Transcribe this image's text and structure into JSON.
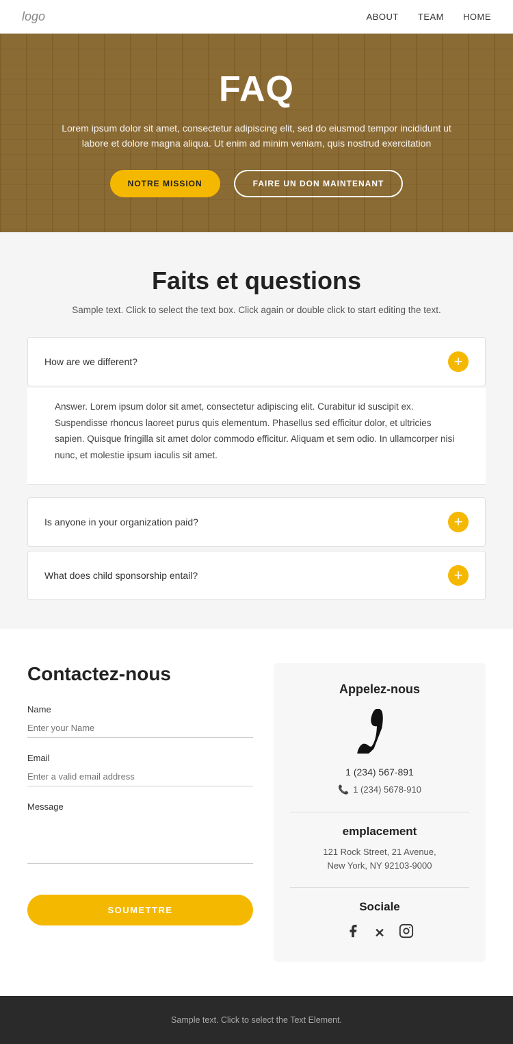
{
  "nav": {
    "logo": "logo",
    "links": [
      {
        "label": "ABOUT",
        "name": "about"
      },
      {
        "label": "TEAM",
        "name": "team"
      },
      {
        "label": "HOME",
        "name": "home"
      }
    ]
  },
  "hero": {
    "title": "FAQ",
    "subtitle": "Lorem ipsum dolor sit amet, consectetur adipiscing elit, sed do eiusmod tempor incididunt ut labore et dolore magna aliqua. Ut enim ad minim veniam, quis nostrud exercitation",
    "btn_primary": "NOTRE MISSION",
    "btn_outline": "FAIRE UN DON MAINTENANT"
  },
  "faq_section": {
    "title": "Faits et questions",
    "subtitle": "Sample text. Click to select the text box. Click again or double click to start editing the text.",
    "items": [
      {
        "question": "How are we different?",
        "answer": "Answer. Lorem ipsum dolor sit amet, consectetur adipiscing elit. Curabitur id suscipit ex. Suspendisse rhoncus laoreet purus quis elementum. Phasellus sed efficitur dolor, et ultricies sapien. Quisque fringilla sit amet dolor commodo efficitur. Aliquam et sem odio. In ullamcorper nisi nunc, et molestie ipsum iaculis sit amet.",
        "open": true
      },
      {
        "question": "Is anyone in your organization paid?",
        "answer": "",
        "open": false
      },
      {
        "question": "What does child sponsorship entail?",
        "answer": "",
        "open": false
      }
    ]
  },
  "contact": {
    "title": "Contactez-nous",
    "name_label": "Name",
    "name_placeholder": "Enter your Name",
    "email_label": "Email",
    "email_placeholder": "Enter a valid email address",
    "message_label": "Message",
    "submit_label": "SOUMETTRE",
    "info": {
      "call_title": "Appelez-nous",
      "phone_main": "1 (234) 567-891",
      "phone_secondary": "1 (234) 5678-910",
      "location_title": "emplacement",
      "address_line1": "121 Rock Street, 21 Avenue,",
      "address_line2": "New York, NY 92103-9000",
      "social_title": "Sociale"
    }
  },
  "footer": {
    "text": "Sample text. Click to select the Text Element."
  }
}
